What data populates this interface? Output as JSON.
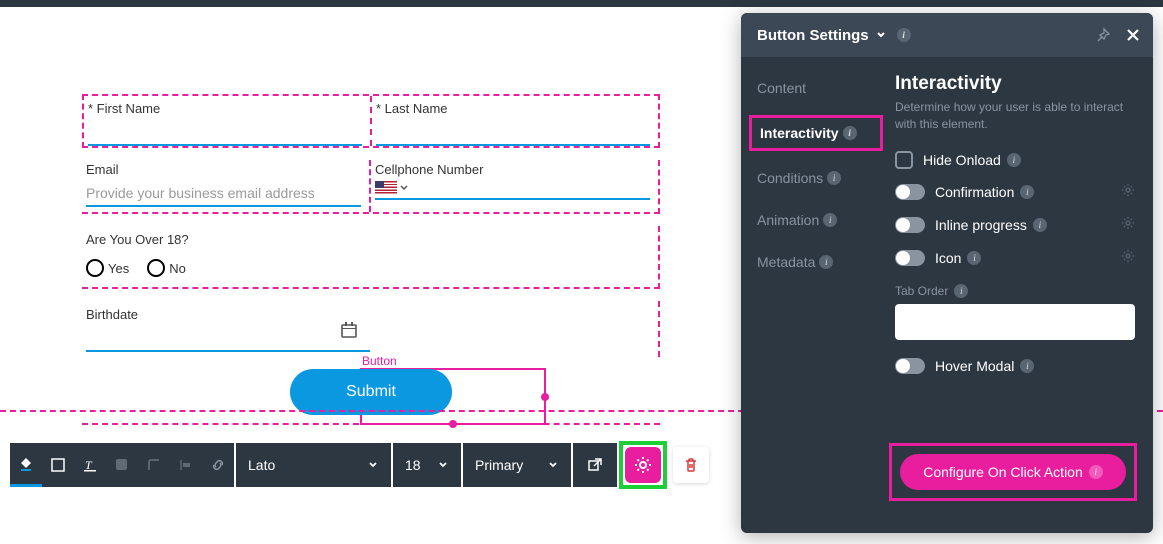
{
  "form": {
    "first_name_label": "* First Name",
    "last_name_label": "* Last Name",
    "email_label": "Email",
    "email_placeholder": "Provide your business email address",
    "cellphone_label": "Cellphone Number",
    "over18_label": "Are You Over 18?",
    "over18_yes": "Yes",
    "over18_no": "No",
    "birthdate_label": "Birthdate",
    "button_tag": "Button",
    "submit_label": "Submit"
  },
  "toolbar": {
    "font": "Lato",
    "font_size": "18",
    "color_scheme": "Primary"
  },
  "panel": {
    "title": "Button Settings",
    "tabs": {
      "content": "Content",
      "interactivity": "Interactivity",
      "conditions": "Conditions",
      "animation": "Animation",
      "metadata": "Metadata"
    },
    "section": {
      "title": "Interactivity",
      "desc": "Determine how your user is able to interact with this element.",
      "hide_onload": "Hide Onload",
      "confirmation": "Confirmation",
      "inline_progress": "Inline progress",
      "icon": "Icon",
      "tab_order": "Tab Order",
      "hover_modal": "Hover Modal",
      "configure_action": "Configure On Click Action"
    }
  }
}
